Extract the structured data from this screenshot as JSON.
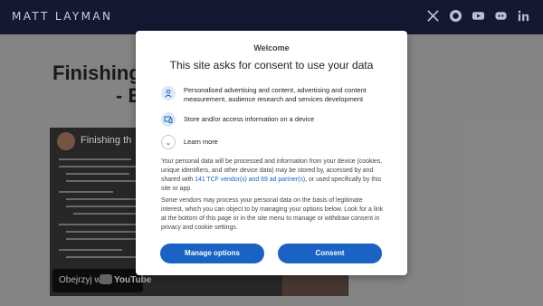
{
  "header": {
    "brand": "MATT LAYMAN",
    "socials": [
      "x-icon",
      "github-icon",
      "youtube-icon",
      "discord-icon",
      "linkedin-icon"
    ]
  },
  "article": {
    "title_line1": "Finishing",
    "title_line2": "- E"
  },
  "video": {
    "title": "Finishing th",
    "watch_label": "Obejrzyj w",
    "yt_text": "YouTube"
  },
  "consent": {
    "welcome": "Welcome",
    "headline": "This site asks for consent to use your data",
    "purposes": [
      {
        "label": "Personalised advertising and content, advertising and content measurement, audience research and services development",
        "icon": "person-icon"
      },
      {
        "label": "Store and/or access information on a device",
        "icon": "device-icon"
      }
    ],
    "learn_more": "Learn more",
    "para1_a": "Your personal data will be processed and information from your device (cookies, unique identifiers, and other device data) may be stored by, accessed by and shared with ",
    "para1_link": "141 TCF vendor(s) and 69 ad partner(s)",
    "para1_b": ", or used specifically by this site or app.",
    "para2": "Some vendors may process your personal data on the basis of legitimate interest, which you can object to by managing your options below. Look for a link at the bottom of this page or in the site menu to manage or withdraw consent in privacy and cookie settings.",
    "manage_label": "Manage options",
    "consent_label": "Consent"
  },
  "colors": {
    "accent": "#1a63c4",
    "header_bg": "#171a34"
  }
}
